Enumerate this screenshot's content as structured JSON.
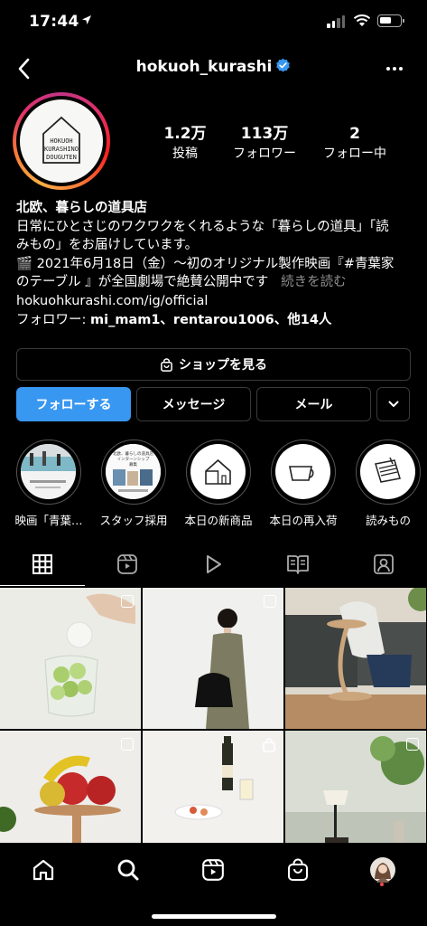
{
  "status_bar": {
    "time": "17:44"
  },
  "header": {
    "username": "hokuoh_kurashi"
  },
  "profile": {
    "avatar_text": [
      "HOKUOH",
      "KURASHINO",
      "DOUGUTEN"
    ],
    "stats": [
      {
        "value": "1.2万",
        "label": "投稿"
      },
      {
        "value": "113万",
        "label": "フォロワー"
      },
      {
        "value": "2",
        "label": "フォロー中"
      }
    ],
    "name": "北欧、暮らしの道具店",
    "bio_line1": "日常にひとさじのワクワクをくれるような「暮らしの道具」「読",
    "bio_line2": "みもの」をお届けしています。",
    "bio_line3": "🎬 2021年6月18日（金）〜初のオリジナル製作映画『#青葉家",
    "bio_line4": "のテーブル 』が全国劇場で絶賛公開中です",
    "more_label": "続きを読む",
    "link": "hokuohkurashi.com/ig/official",
    "followed_by_prefix": "フォロワー: ",
    "followed_by_names": "mi_mam1、rentarou1006、他14人"
  },
  "buttons": {
    "shop": "ショップを見る",
    "follow": "フォローする",
    "message": "メッセージ",
    "mail": "メール"
  },
  "highlights": [
    {
      "label": "映画「青葉…"
    },
    {
      "label": "スタッフ採用"
    },
    {
      "label": "本日の新商品"
    },
    {
      "label": "本日の再入荷"
    },
    {
      "label": "読みもの"
    }
  ],
  "highlight_texts": {
    "staff": [
      "北欧、暮らしの道具店",
      "インターンシップ",
      "募集"
    ]
  },
  "colors": {
    "accent": "#3897f0",
    "background": "#000000",
    "verified": "#3897f0",
    "notification": "#ed4956"
  },
  "tabs": [
    "grid-icon",
    "reels-icon",
    "video-icon",
    "guide-icon",
    "tagged-icon"
  ],
  "nav": [
    "home-icon",
    "search-icon",
    "reels-icon",
    "shop-icon",
    "profile-avatar"
  ]
}
